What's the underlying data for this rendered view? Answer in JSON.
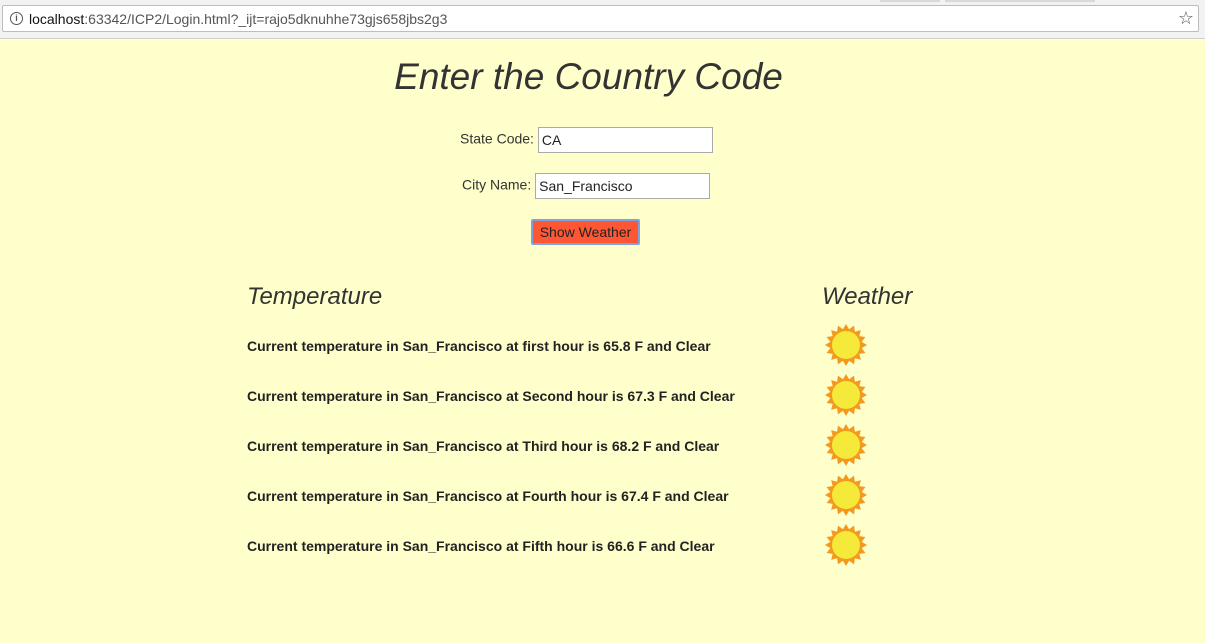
{
  "browser": {
    "url_host": "localhost",
    "url_rest": ":63342/ICP2/Login.html?_ijt=rajo5dknuhhe73gjs658jbs2g3"
  },
  "page": {
    "title": "Enter the Country Code"
  },
  "form": {
    "state_label": "State Code:",
    "state_value": "CA",
    "city_label": "City Name:",
    "city_value": "San_Francisco",
    "button_label": "Show Weather"
  },
  "results": {
    "temperature_heading": "Temperature",
    "weather_heading": "Weather",
    "rows": [
      {
        "text": "Current temperature in San_Francisco at first hour is 65.8 F and Clear",
        "icon": "sun-icon"
      },
      {
        "text": "Current temperature in San_Francisco at Second hour is 67.3 F and Clear",
        "icon": "sun-icon"
      },
      {
        "text": "Current temperature in San_Francisco at Third hour is 68.2 F and Clear",
        "icon": "sun-icon"
      },
      {
        "text": "Current temperature in San_Francisco at Fourth hour is 67.4 F and Clear",
        "icon": "sun-icon"
      },
      {
        "text": "Current temperature in San_Francisco at Fifth hour is 66.6 F and Clear",
        "icon": "sun-icon"
      }
    ]
  },
  "colors": {
    "page_background": "#ffffcc",
    "button_background": "#ff5733",
    "sun_fill": "#f5ea3a",
    "sun_rays": "#f39a1e"
  }
}
